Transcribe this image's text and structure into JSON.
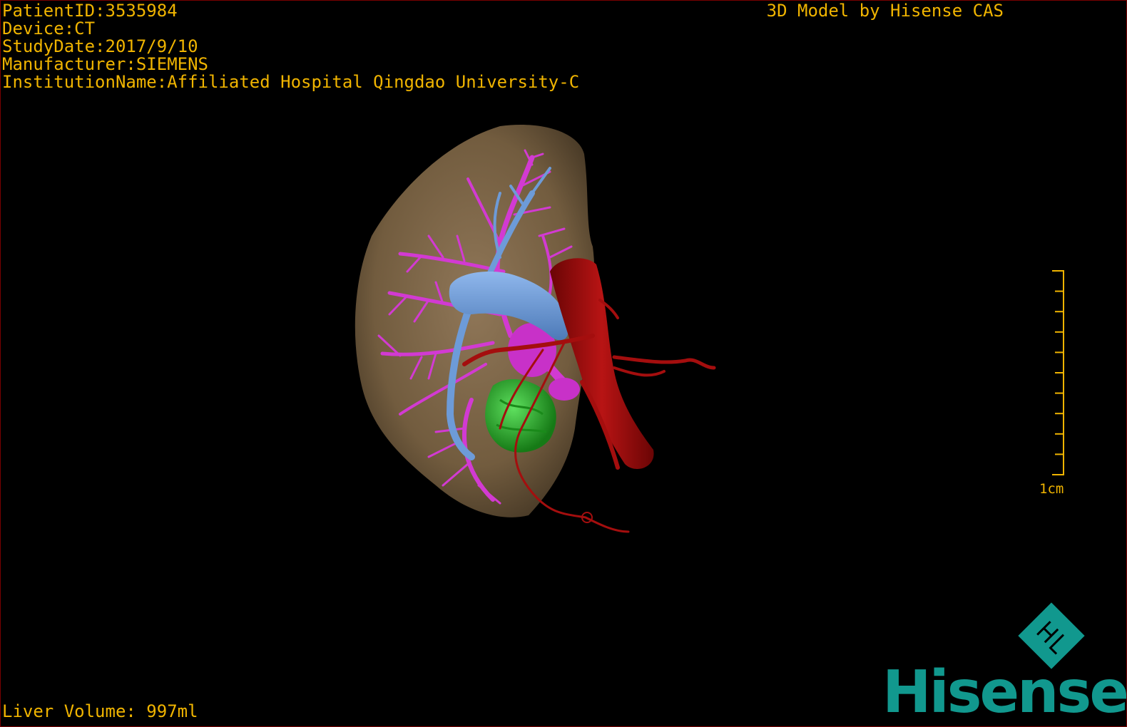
{
  "metadata": {
    "patient_id": "PatientID:3535984",
    "device": "Device:CT",
    "study_date": "StudyDate:2017/9/10",
    "manufacturer": "Manufacturer:SIEMENS",
    "institution": "InstitutionName:Affiliated Hospital Qingdao University-C"
  },
  "caption": "3D Model by Hisense CAS",
  "liver_volume": "Liver Volume: 997ml",
  "scale_bar": {
    "label": "1cm",
    "tick_count": 10
  },
  "logo": {
    "word": "Hisense",
    "mark_letters": "H L",
    "color": "#11988e"
  },
  "colors": {
    "overlay_text": "#f0b400",
    "liver": "#8c7350",
    "portal_vein": "#d23ad2",
    "hepatic_vein": "#6d9bd8",
    "artery_aorta": "#a40e0e",
    "tumor": "#2fb52f",
    "frame": "#7a0000"
  }
}
